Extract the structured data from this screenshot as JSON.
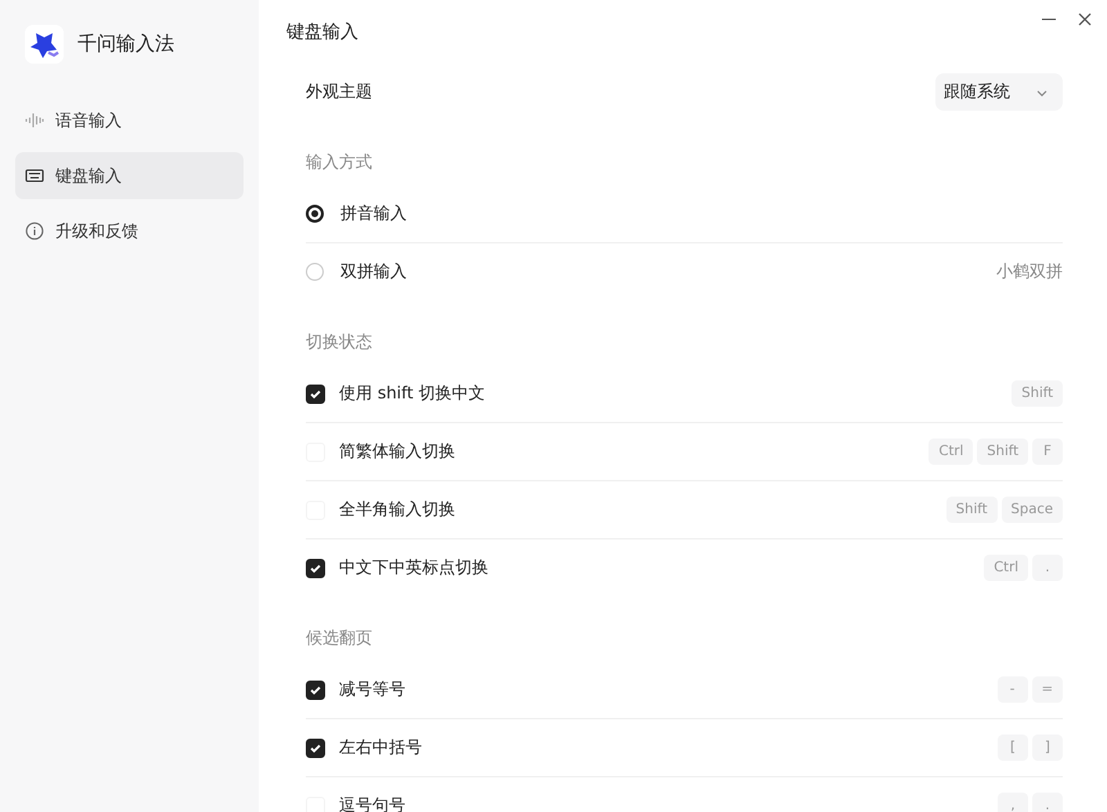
{
  "sidebar": {
    "app_name": "千问输入法",
    "items": [
      {
        "kind": "voice",
        "label": "语音输入",
        "selected": false
      },
      {
        "kind": "keyboard",
        "label": "键盘输入",
        "selected": true
      },
      {
        "kind": "info",
        "label": "升级和反馈",
        "selected": false
      }
    ]
  },
  "page_title": "键盘输入",
  "theme": {
    "label": "外观主题",
    "value": "跟随系统"
  },
  "sections": [
    {
      "heading": "输入方式",
      "rows": [
        {
          "kind": "radio",
          "label": "拼音输入",
          "selected": true
        },
        {
          "kind": "radio",
          "label": "双拼输入",
          "selected": false,
          "detail": "小鹤双拼"
        }
      ]
    },
    {
      "heading": "切换状态",
      "rows": [
        {
          "kind": "checkbox",
          "label": "使用 shift 切换中文",
          "checked": true,
          "keys": [
            "Shift"
          ]
        },
        {
          "kind": "checkbox",
          "label": "简繁体输入切换",
          "checked": false,
          "keys": [
            "Ctrl",
            "Shift",
            "F"
          ]
        },
        {
          "kind": "checkbox",
          "label": "全半角输入切换",
          "checked": false,
          "keys": [
            "Shift",
            "Space"
          ]
        },
        {
          "kind": "checkbox",
          "label": "中文下中英标点切换",
          "checked": true,
          "keys": [
            "Ctrl",
            "."
          ]
        }
      ]
    },
    {
      "heading": "候选翻页",
      "rows": [
        {
          "kind": "checkbox",
          "label": "减号等号",
          "checked": true,
          "keys": [
            "-",
            "="
          ]
        },
        {
          "kind": "checkbox",
          "label": "左右中括号",
          "checked": true,
          "keys": [
            "[",
            "]"
          ]
        },
        {
          "kind": "checkbox",
          "label": "逗号句号",
          "checked": false,
          "keys": [
            ",",
            "."
          ]
        }
      ]
    }
  ]
}
